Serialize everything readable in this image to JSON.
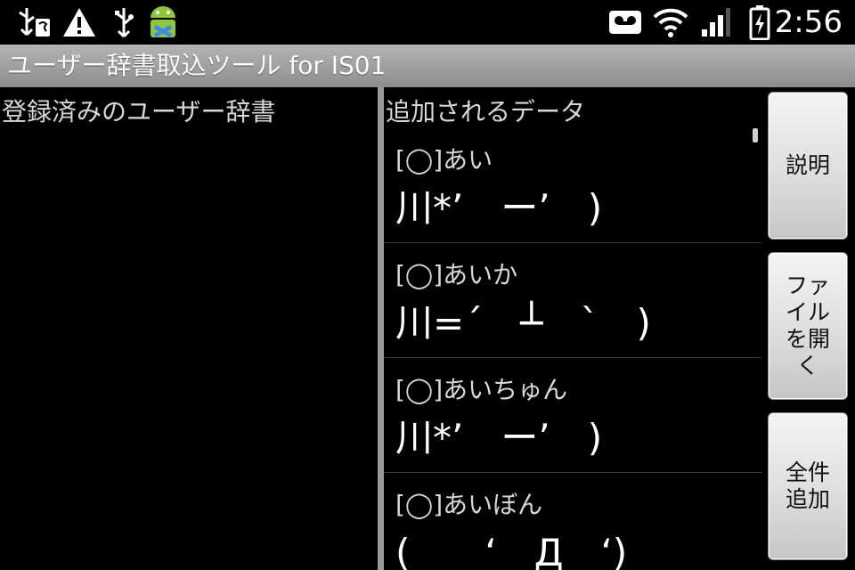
{
  "status_bar": {
    "icons": [
      "usb-debug-icon",
      "warning-icon",
      "usb-icon",
      "android-icon",
      "voicemail-icon",
      "wifi-icon",
      "signal-icon",
      "battery-icon"
    ],
    "time": "2:56"
  },
  "app": {
    "title": "ユーザー辞書取込ツール for IS01"
  },
  "left_pane": {
    "heading": "登録済みのユーザー辞書"
  },
  "right_pane": {
    "heading": "追加されるデータ",
    "items": [
      {
        "key": "[◯]あい",
        "value": "川*’　ー’　)"
      },
      {
        "key": "[◯]あいか",
        "value": "川=´　┴　`　)"
      },
      {
        "key": "[◯]あいちゅん",
        "value": "川*’　ー’　)"
      },
      {
        "key": "[◯]あいぼん",
        "value": "(　　‘　Д　‘)"
      }
    ]
  },
  "buttons": {
    "explain": "説明",
    "open_file": "ファイルを開く",
    "add_all": "全件追加"
  }
}
